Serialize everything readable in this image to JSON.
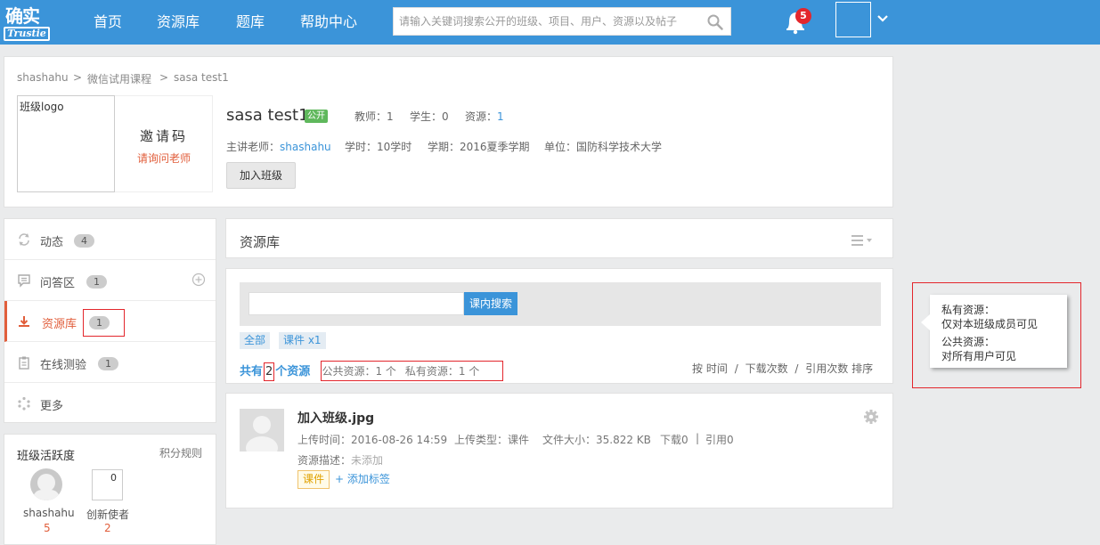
{
  "header": {
    "logo_top": "确实",
    "logo_bottom": "Trustie",
    "nav": [
      "首页",
      "资源库",
      "题库",
      "帮助中心"
    ],
    "search_placeholder": "请输入关键词搜索公开的班级、项目、用户、资源以及帖子",
    "notification_count": "5",
    "brand_color": "#3b94d9"
  },
  "breadcrumb": [
    "shashahu",
    "微信试用课程",
    "sasa test1"
  ],
  "breadcrumb_sep": ">",
  "course": {
    "logo_alt": "班级logo",
    "invite_title": "邀请码",
    "invite_hint": "请询问老师",
    "name": "sasa test1",
    "visibility": "公开",
    "teachers_label": "教师：",
    "teachers": "1",
    "students_label": "学生：",
    "students": "0",
    "resources_label": "资源：",
    "resources": "1",
    "lecturer_label": "主讲老师：",
    "lecturer": "shashahu",
    "hours_label": "学时：",
    "hours": "10学时",
    "term_label": "学期：",
    "term": "2016夏季学期",
    "unit_label": "单位：",
    "unit": "国防科学技术大学",
    "join_label": "加入班级"
  },
  "sidebar": {
    "items": [
      {
        "label": "动态",
        "count": "4",
        "icon": "refresh-icon"
      },
      {
        "label": "问答区",
        "count": "1",
        "icon": "comment-icon"
      },
      {
        "label": "资源库",
        "count": "1",
        "icon": "download-icon",
        "active": true
      },
      {
        "label": "在线测验",
        "count": "1",
        "icon": "clipboard-icon"
      },
      {
        "label": "更多",
        "icon": "dots-icon"
      }
    ],
    "active_color": "#e15e3b"
  },
  "activity": {
    "title": "班级活跃度",
    "rules": "积分规则",
    "users": [
      {
        "name": "shashahu",
        "score": "5"
      },
      {
        "name": "创新使者",
        "score": "2",
        "img_alt": "0"
      }
    ]
  },
  "resources": {
    "title": "资源库",
    "search_button": "课内搜索",
    "filters": [
      "全部",
      "课件 x1"
    ],
    "count_prefix": "共有",
    "count": "2",
    "count_suffix": "个资源",
    "public_text": "公共资源：1 个",
    "private_text": "私有资源：1 个",
    "sort_by": "按",
    "sort_options": [
      "时间",
      "下载次数",
      "引用次数"
    ],
    "sort_sep": "/",
    "sort_suffix": "排序",
    "items": [
      {
        "name": "加入班级.jpg",
        "upload_time": "上传时间：2016-08-26 14:59",
        "upload_type": "上传类型：课件",
        "file_size": "文件大小：35.822 KB",
        "downloads": "下载0",
        "sep": "|",
        "refs": "引用0",
        "desc_label": "资源描述：",
        "desc_value": "未添加",
        "tag": "课件",
        "add_tag": "+ 添加标签"
      }
    ]
  },
  "annotation": {
    "lines": [
      "私有资源：",
      "仅对本班级成员可见",
      "公共资源：",
      "对所有用户可见"
    ],
    "highlight_color": "#e3262c"
  }
}
